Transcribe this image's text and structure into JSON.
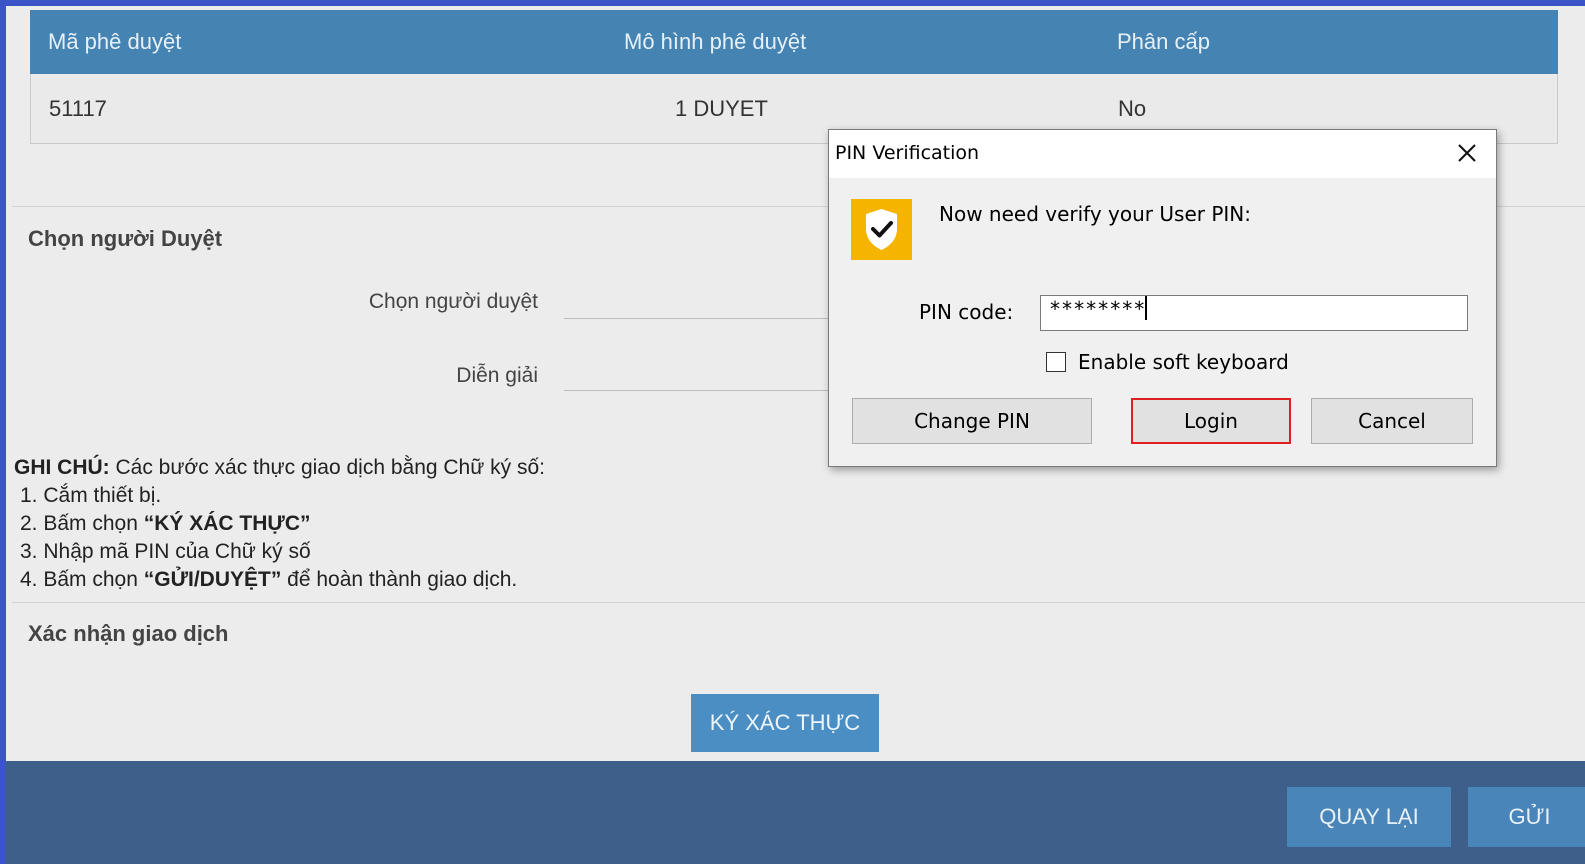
{
  "approval_table": {
    "headers": [
      "Mã phê duyệt",
      "Mô hình phê duyệt",
      "Phân cấp"
    ],
    "rows": [
      [
        "51117",
        "1 DUYET",
        "No"
      ]
    ]
  },
  "approver_section": {
    "title": "Chọn người Duyệt",
    "approver_label": "Chọn người duyệt",
    "description_label": "Diễn giải"
  },
  "note": {
    "heading": "GHI CHÚ:",
    "intro": " Các bước xác thực giao dịch bằng Chữ ký số:",
    "step1": "1. Cắm thiết bị.",
    "step2_prefix": "2. Bấm chọn ",
    "step2_bold": "“KÝ XÁC THỰC”",
    "step3": "3. Nhập mã PIN của Chữ ký số",
    "step4_prefix": "4. Bấm chọn ",
    "step4_bold": "“GỬI/DUYỆT”",
    "step4_suffix": " để hoàn thành giao dịch."
  },
  "confirm_section": {
    "title": "Xác nhận giao dịch",
    "sign_button": "KÝ XÁC THỰC"
  },
  "footer": {
    "back_button": "QUAY LẠI",
    "send_button": "GỬI"
  },
  "dialog": {
    "title": "PIN Verification",
    "message": "Now need verify your User PIN:",
    "pin_label": "PIN code:",
    "pin_value": "********",
    "soft_keyboard_label": "Enable soft keyboard",
    "soft_keyboard_checked": false,
    "change_pin_button": "Change PIN",
    "login_button": "Login",
    "cancel_button": "Cancel",
    "icon": "shield-check-icon",
    "colors": {
      "shield": "#f5b400",
      "highlight": "#e02020"
    }
  }
}
